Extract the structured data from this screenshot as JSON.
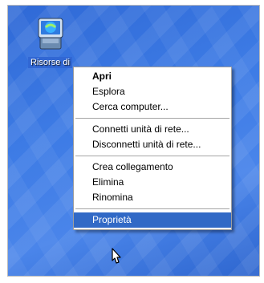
{
  "desktop": {
    "icon": {
      "label": "Risorse di",
      "icon": "my-computer-icon"
    }
  },
  "context_menu": {
    "groups": [
      [
        {
          "label": "Apri",
          "default": true
        },
        {
          "label": "Esplora"
        },
        {
          "label": "Cerca computer..."
        }
      ],
      [
        {
          "label": "Connetti unità di rete..."
        },
        {
          "label": "Disconnetti unità di rete..."
        }
      ],
      [
        {
          "label": "Crea collegamento"
        },
        {
          "label": "Elimina"
        },
        {
          "label": "Rinomina"
        }
      ],
      [
        {
          "label": "Proprietà",
          "highlighted": true
        }
      ]
    ]
  },
  "colors": {
    "desktop_blue": "#3d7be5",
    "menu_highlight": "#3169c6"
  }
}
